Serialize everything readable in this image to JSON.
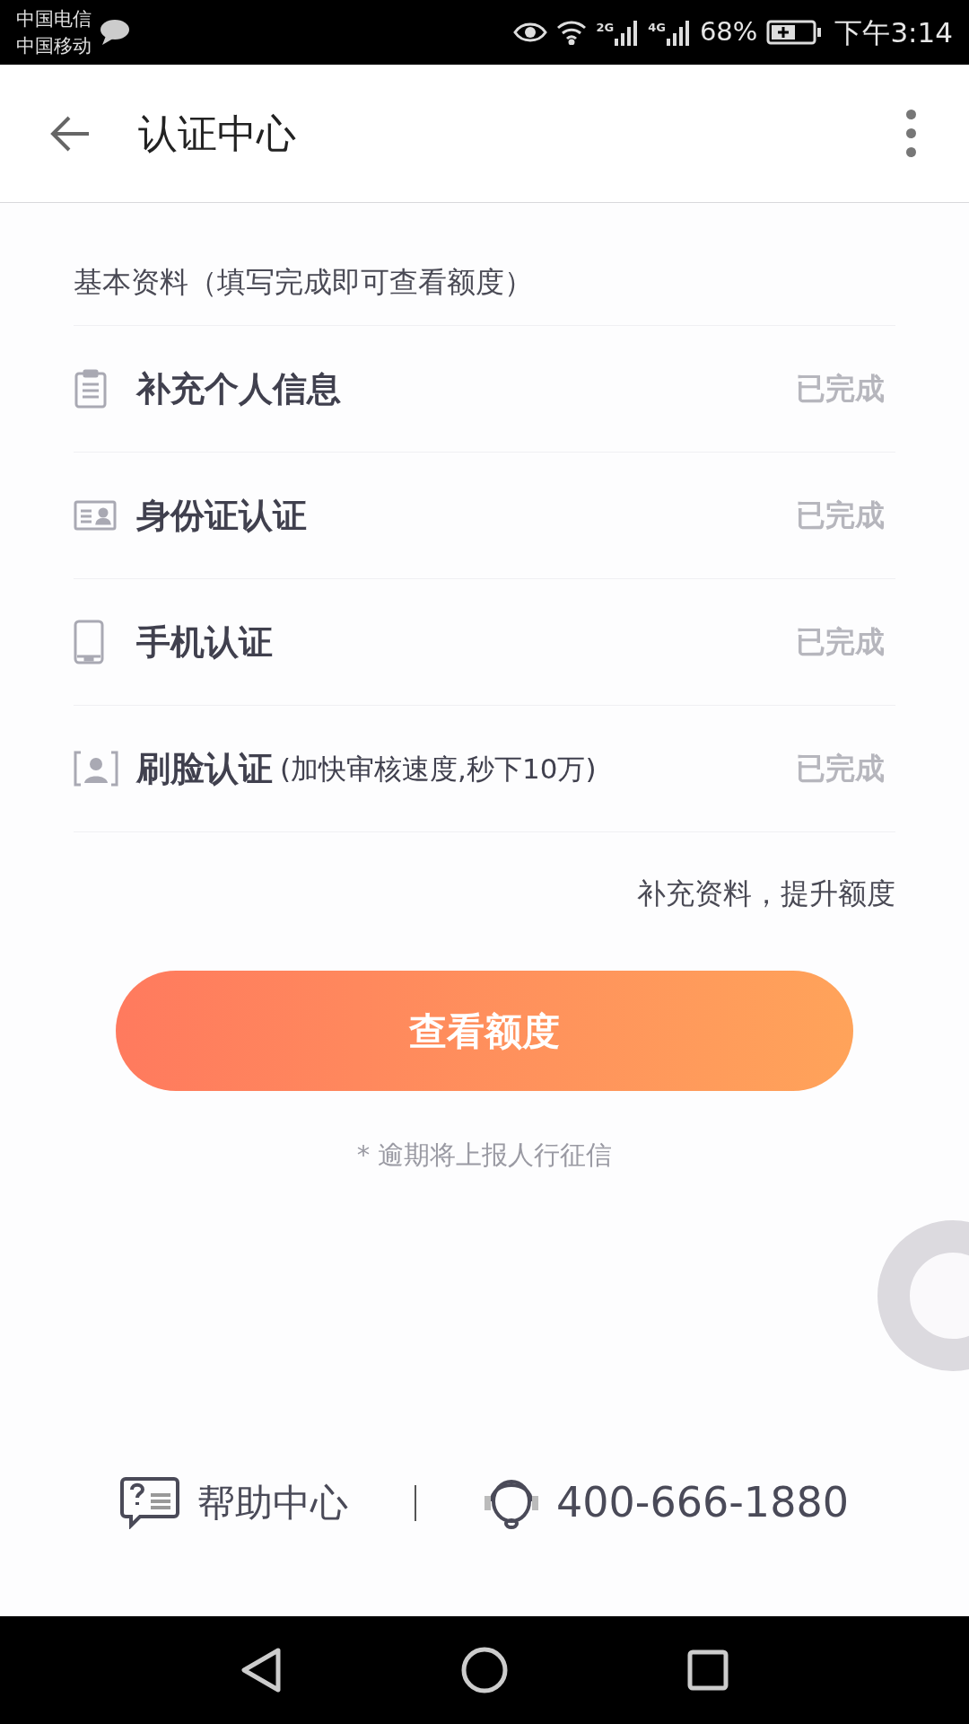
{
  "status_bar": {
    "carriers": [
      "中国电信",
      "中国移动"
    ],
    "network_1": "2G",
    "network_2": "4G",
    "battery": "68%",
    "time": "下午3:14"
  },
  "header": {
    "title": "认证中心"
  },
  "section": {
    "title": "基本资料（填写完成即可查看额度）"
  },
  "items": [
    {
      "title": "补充个人信息",
      "status": "已完成"
    },
    {
      "title": "身份证认证",
      "status": "已完成"
    },
    {
      "title": "手机认证",
      "status": "已完成"
    },
    {
      "title": "刷脸认证",
      "note": "(加快审核速度,秒下10万)",
      "status": "已完成"
    }
  ],
  "more_link": "补充资料，提升额度",
  "primary_button": "查看额度",
  "notice": "* 逾期将上报人行征信",
  "footer": {
    "help": "帮助中心",
    "phone": "400-666-1880"
  }
}
